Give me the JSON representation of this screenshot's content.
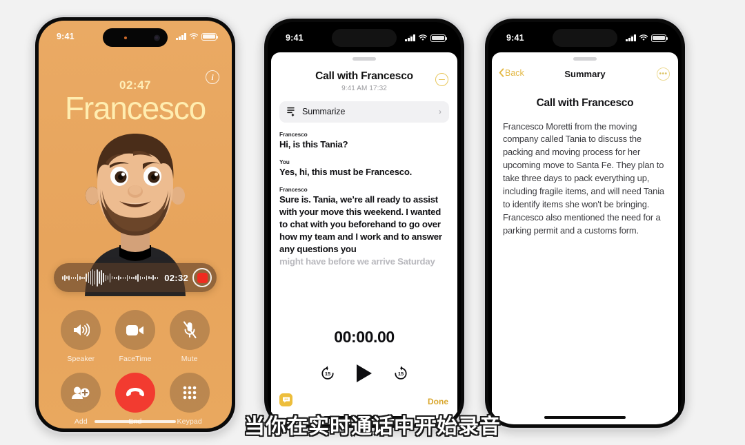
{
  "subtitle": "当你在实时通话中开始录音",
  "phone1": {
    "status": {
      "time": "9:41",
      "cell_icon": "cellular-signal-icon",
      "wifi_icon": "wifi-icon",
      "battery_icon": "battery-icon"
    },
    "info_button": "i",
    "call_timer": "02:47",
    "caller_name": "Francesco",
    "avatar": "memoji-avatar",
    "recording": {
      "time": "02:32",
      "stop_icon": "stop-recording-icon",
      "waveform": "audio-waveform"
    },
    "controls": [
      {
        "label": "Speaker",
        "icon": "speaker-icon"
      },
      {
        "label": "FaceTime",
        "icon": "video-camera-icon"
      },
      {
        "label": "Mute",
        "icon": "microphone-muted-icon"
      },
      {
        "label": "Add",
        "icon": "add-person-icon"
      },
      {
        "label": "End",
        "icon": "end-call-icon"
      },
      {
        "label": "Keypad",
        "icon": "keypad-icon"
      }
    ]
  },
  "phone2": {
    "status": {
      "time": "9:41"
    },
    "title": "Call with Francesco",
    "subtitle": "9:41 AM  17:32",
    "collapse_icon": "collapse-icon",
    "summarize": {
      "label": "Summarize",
      "icon": "summarize-icon",
      "chevron": "›"
    },
    "transcript": [
      {
        "speaker": "Francesco",
        "text": "Hi, is this Tania?",
        "faded": false
      },
      {
        "speaker": "You",
        "text": "Yes, hi, this must be Francesco.",
        "faded": false
      },
      {
        "speaker": "Francesco",
        "text": "Sure is. Tania, we’re all ready to assist with your move this weekend. I wanted to chat with you beforehand to go over how my team and I work and to answer any questions you",
        "faded": false
      },
      {
        "speaker": "",
        "text": "might have before we arrive Saturday",
        "faded": true
      }
    ],
    "player": {
      "time": "00:00.00",
      "back_label": "15",
      "forward_label": "15",
      "play_icon": "play-icon"
    },
    "chat_badge_icon": "chat-bubble-icon",
    "done_label": "Done"
  },
  "phone3": {
    "status": {
      "time": "9:41"
    },
    "back_label": "Back",
    "nav_title": "Summary",
    "more_label": "•••",
    "heading": "Call with Francesco",
    "body": "Francesco Moretti from the moving company called Tania to discuss the packing and moving process for her upcoming move to Santa Fe. They plan to take three days to pack everything up, including fragile items, and will need Tania to identify items she won't be bringing. Francesco also mentioned the need for a parking permit and a customs form."
  },
  "colors": {
    "accent_orange": "#e8a861",
    "name_yellow": "#ffedb0",
    "yellow": "#e8c75c",
    "red": "#f23b30"
  }
}
